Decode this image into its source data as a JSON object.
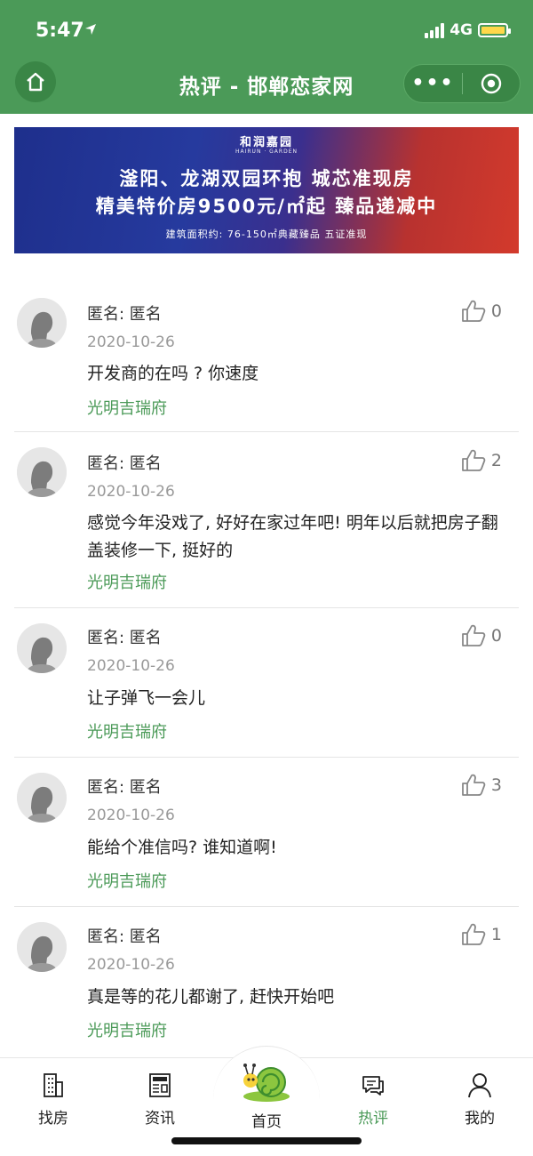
{
  "status_bar": {
    "time": "5:47",
    "network": "4G"
  },
  "header": {
    "title": "热评 - 邯郸恋家网",
    "more_label": "•••"
  },
  "banner": {
    "brand": "和润嘉园",
    "brand_sub": "HAIRUN · GARDEN",
    "line1": "滏阳、龙湖双园环抱  城芯准现房",
    "line2": "精美特价房9500元/㎡起  臻品递减中",
    "note": "建筑面积约: 76-150㎡典藏臻品  五证准现"
  },
  "comments": [
    {
      "name": "匿名: 匿名",
      "date": "2020-10-26",
      "text": "开发商的在吗 ? 你速度",
      "tag": "光明吉瑞府",
      "likes": "0"
    },
    {
      "name": "匿名: 匿名",
      "date": "2020-10-26",
      "text": "感觉今年没戏了, 好好在家过年吧! 明年以后就把房子翻盖装修一下, 挺好的",
      "tag": "光明吉瑞府",
      "likes": "2"
    },
    {
      "name": "匿名: 匿名",
      "date": "2020-10-26",
      "text": "让子弹飞一会儿",
      "tag": "光明吉瑞府",
      "likes": "0"
    },
    {
      "name": "匿名: 匿名",
      "date": "2020-10-26",
      "text": "能给个准信吗? 谁知道啊!",
      "tag": "光明吉瑞府",
      "likes": "3"
    },
    {
      "name": "匿名: 匿名",
      "date": "2020-10-26",
      "text": "真是等的花儿都谢了, 赶快开始吧",
      "tag": "光明吉瑞府",
      "likes": "1"
    }
  ],
  "nav": [
    {
      "label": "找房",
      "icon": "building-icon"
    },
    {
      "label": "资讯",
      "icon": "news-icon"
    },
    {
      "label": "首页",
      "icon": "snail-logo-icon"
    },
    {
      "label": "热评",
      "icon": "chat-icon",
      "active": true
    },
    {
      "label": "我的",
      "icon": "user-icon"
    }
  ],
  "colors": {
    "brand_green": "#4b9a58",
    "text": "#222222",
    "muted": "#999999"
  }
}
